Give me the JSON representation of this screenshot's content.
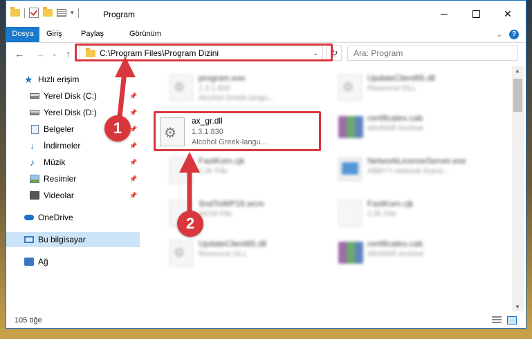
{
  "window": {
    "title": "Program"
  },
  "ribbon": {
    "tabs": [
      "Dosya",
      "Giriş",
      "Paylaş",
      "Görünüm"
    ],
    "help": "?"
  },
  "address": {
    "path": "C:\\Program Files\\Program Dizini",
    "search_placeholder": "Ara: Program"
  },
  "nav_pane": {
    "quick_access": "Hızlı erişim",
    "items": [
      {
        "label": "Yerel Disk (C:)",
        "icon": "drive-icon"
      },
      {
        "label": "Yerel Disk (D:)",
        "icon": "drive-icon"
      },
      {
        "label": "Belgeler",
        "icon": "documents-icon"
      },
      {
        "label": "İndirmeler",
        "icon": "download-icon"
      },
      {
        "label": "Müzik",
        "icon": "music-icon"
      },
      {
        "label": "Resimler",
        "icon": "pictures-icon"
      },
      {
        "label": "Videolar",
        "icon": "videos-icon"
      }
    ],
    "onedrive": "OneDrive",
    "this_pc": "Bu bilgisayar",
    "network": "Ağ"
  },
  "files": [
    {
      "name": "program.exe",
      "line1": "1.3.1.830",
      "line2": "Alcohol Greek-langu..."
    },
    {
      "name": "UpdateClient65.dll",
      "line1": "Resource DLL",
      "line2": ""
    },
    {
      "name": "certificates.cab",
      "line1": "WinRAR Archive",
      "line2": ""
    },
    {
      "name": "NetworkLicenseServer.exe",
      "line1": "ABBYY network licens...",
      "line2": ""
    },
    {
      "name": "FastKorn.cjk",
      "line1": "CJK File",
      "line2": ""
    },
    {
      "name": "SndToWP16.wcm",
      "line1": "WCM File",
      "line2": ""
    },
    {
      "name": "FastKorn.cjk",
      "line1": "CJK File",
      "line2": ""
    },
    {
      "name": "UpdateClient65.dll",
      "line1": "Resource DLL",
      "line2": ""
    },
    {
      "name": "certificates.cab",
      "line1": "WinRAR Archive",
      "line2": ""
    }
  ],
  "highlighted_file": {
    "name": "ax_gr.dll",
    "line1": "1.3.1.830",
    "line2": "Alcohol Greek-langu..."
  },
  "status": {
    "count": "105 öğe"
  },
  "annotations": {
    "step1": "1",
    "step2": "2"
  },
  "colors": {
    "accent": "#1979ca",
    "highlight": "#d9363e",
    "selected": "#cce4f7"
  }
}
